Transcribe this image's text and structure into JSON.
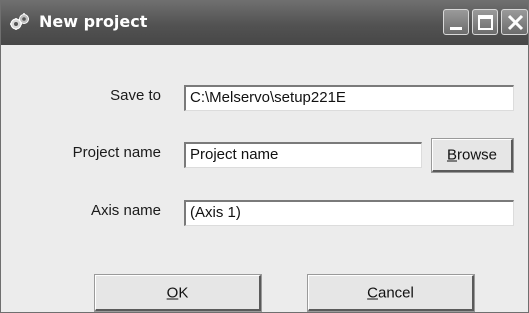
{
  "window": {
    "title": "New project",
    "app_icon": "network-gears-icon",
    "controls": [
      "minimize-icon",
      "maximize-icon",
      "close-icon"
    ]
  },
  "form": {
    "save_to": {
      "label": "Save to",
      "value": "C:\\Melservo\\setup221E"
    },
    "project_name": {
      "label": "Project name",
      "value": "Project name"
    },
    "axis_name": {
      "label": "Axis name",
      "value": "(Axis 1)"
    }
  },
  "buttons": {
    "browse": {
      "mnemonic": "B",
      "rest": "rowse"
    },
    "ok": {
      "mnemonic": "O",
      "rest": "K"
    },
    "cancel": {
      "mnemonic": "C",
      "rest": "ancel"
    }
  }
}
